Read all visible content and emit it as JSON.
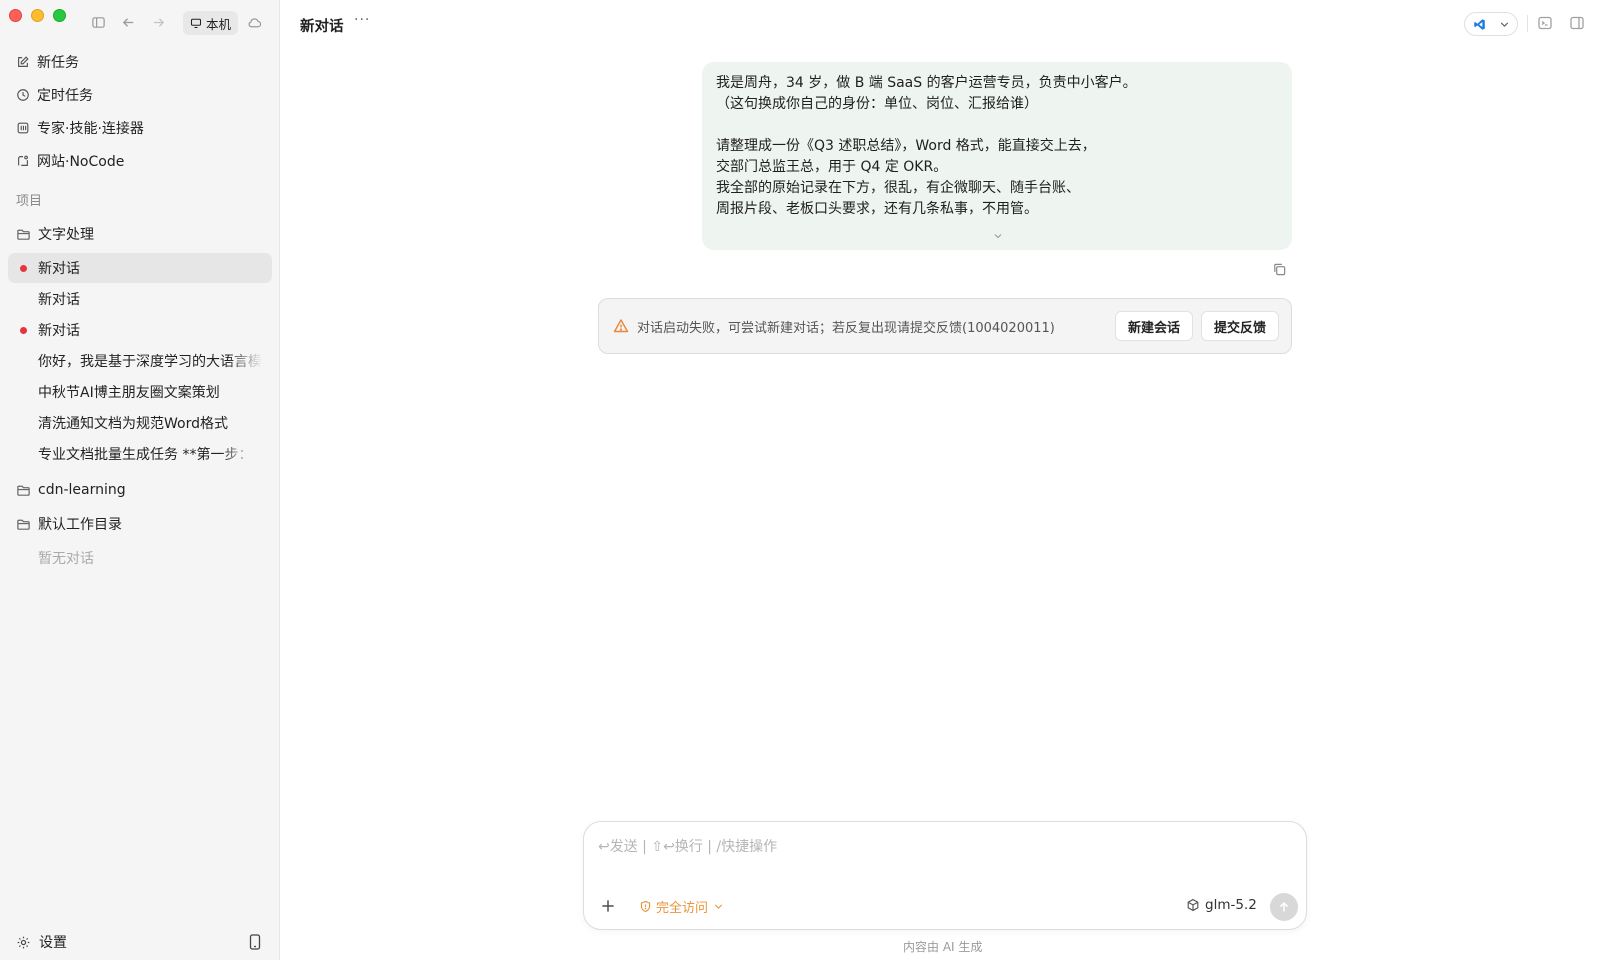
{
  "window": {
    "local_label": "本机"
  },
  "sidebar": {
    "nav": [
      {
        "label": "新任务",
        "icon": "edit-icon"
      },
      {
        "label": "定时任务",
        "icon": "clock-icon"
      },
      {
        "label": "专家·技能·连接器",
        "icon": "grid-icon"
      },
      {
        "label": "网站·NoCode",
        "icon": "site-icon"
      }
    ],
    "section_label": "项目",
    "projects": [
      {
        "name": "文字处理",
        "conversations": [
          {
            "title": "新对话",
            "unread": true,
            "active": true
          },
          {
            "title": "新对话",
            "unread": false,
            "active": false
          },
          {
            "title": "新对话",
            "unread": true,
            "active": false
          },
          {
            "title": "你好，我是基于深度学习的大语言模",
            "unread": false,
            "active": false
          },
          {
            "title": "中秋节AI博主朋友圈文案策划",
            "unread": false,
            "active": false
          },
          {
            "title": "清洗通知文档为规范Word格式",
            "unread": false,
            "active": false
          },
          {
            "title": "专业文档批量生成任务 **第一步：",
            "unread": false,
            "active": false
          }
        ]
      },
      {
        "name": "cdn-learning"
      },
      {
        "name": "默认工作目录",
        "empty_note": "暂无对话"
      }
    ],
    "settings_label": "设置"
  },
  "header": {
    "title": "新对话",
    "more": "···"
  },
  "chat": {
    "user_message_lines": [
      "我是周舟，34 岁，做 B 端 SaaS 的客户运营专员，负责中小客户。",
      "（这句换成你自己的身份：单位、岗位、汇报给谁）",
      "",
      "请整理成一份《Q3 述职总结》，Word 格式，能直接交上去，",
      "交部门总监王总，用于 Q4 定 OKR。",
      "我全部的原始记录在下方，很乱，有企微聊天、随手台账、",
      "周报片段、老板口头要求，还有几条私事，不用管。"
    ],
    "error": {
      "text": "对话启动失败，可尝试新建对话；若反复出现请提交反馈(1004020011)",
      "new_session_label": "新建会话",
      "feedback_label": "提交反馈"
    }
  },
  "composer": {
    "placeholder": "↩发送 | ⇧↩换行 | /快捷操作",
    "access_label": "完全访问",
    "model_label": "glm-5.2"
  },
  "footer": {
    "note": "内容由 AI 生成"
  },
  "colors": {
    "accent_red": "#e5363d",
    "warning_orange": "#e8863a",
    "bubble_bg": "#eef4f0",
    "vscode_blue": "#1f7ae0"
  }
}
